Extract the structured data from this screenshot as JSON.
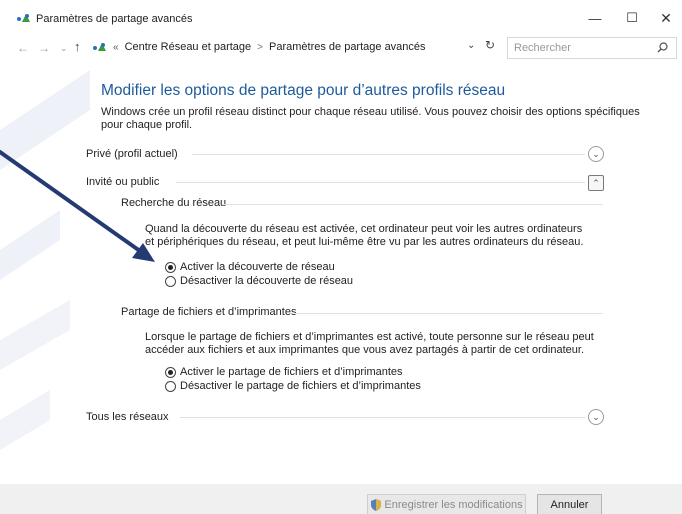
{
  "window": {
    "title": "Paramètres de partage avancés",
    "icon": "network-icon",
    "controls": {
      "minimize": "—",
      "maximize": "☐",
      "close": "✕"
    }
  },
  "nav": {
    "back": "←",
    "forward": "→",
    "recent": "⌄",
    "up": "↑",
    "breadcrumb": {
      "overflow": "«",
      "items": [
        "Centre Réseau et partage",
        "Paramètres de partage avancés"
      ],
      "separator": ">"
    },
    "dropdown": "⌄",
    "refresh": "↻",
    "search_placeholder": "Rechercher"
  },
  "main": {
    "heading": "Modifier les options de partage pour d’autres profils réseau",
    "intro": "Windows crée un profil réseau distinct pour chaque réseau utilisé. Vous pouvez choisir des options spécifiques pour chaque profil.",
    "profiles": {
      "private": {
        "label": "Privé (profil actuel)",
        "expanded": false
      },
      "guest": {
        "label": "Invité ou public",
        "expanded": true,
        "discovery": {
          "title": "Recherche du réseau",
          "description": "Quand la découverte du réseau est activée, cet ordinateur peut voir les autres ordinateurs et périphériques du réseau, et peut lui-même être vu par les autres ordinateurs du réseau.",
          "options": [
            {
              "label": "Activer la découverte de réseau",
              "selected": true
            },
            {
              "label": "Désactiver la découverte de réseau",
              "selected": false
            }
          ]
        },
        "file_sharing": {
          "title": "Partage de fichiers et d’imprimantes",
          "description": "Lorsque le partage de fichiers et d’imprimantes est activé, toute personne sur le réseau peut accéder aux fichiers et aux imprimantes que vous avez partagés à partir de cet ordinateur.",
          "options": [
            {
              "label": "Activer le partage de fichiers et d’imprimantes",
              "selected": true
            },
            {
              "label": "Désactiver le partage de fichiers et d’imprimantes",
              "selected": false
            }
          ]
        }
      },
      "all": {
        "label": "Tous les réseaux",
        "expanded": false
      }
    }
  },
  "footer": {
    "save_label": "Enregistrer les modifications",
    "save_enabled": false,
    "cancel_label": "Annuler"
  },
  "colors": {
    "heading": "#1e5a9c",
    "annotation_arrow": "#243a73",
    "footer_bg": "#f0f0f0"
  }
}
